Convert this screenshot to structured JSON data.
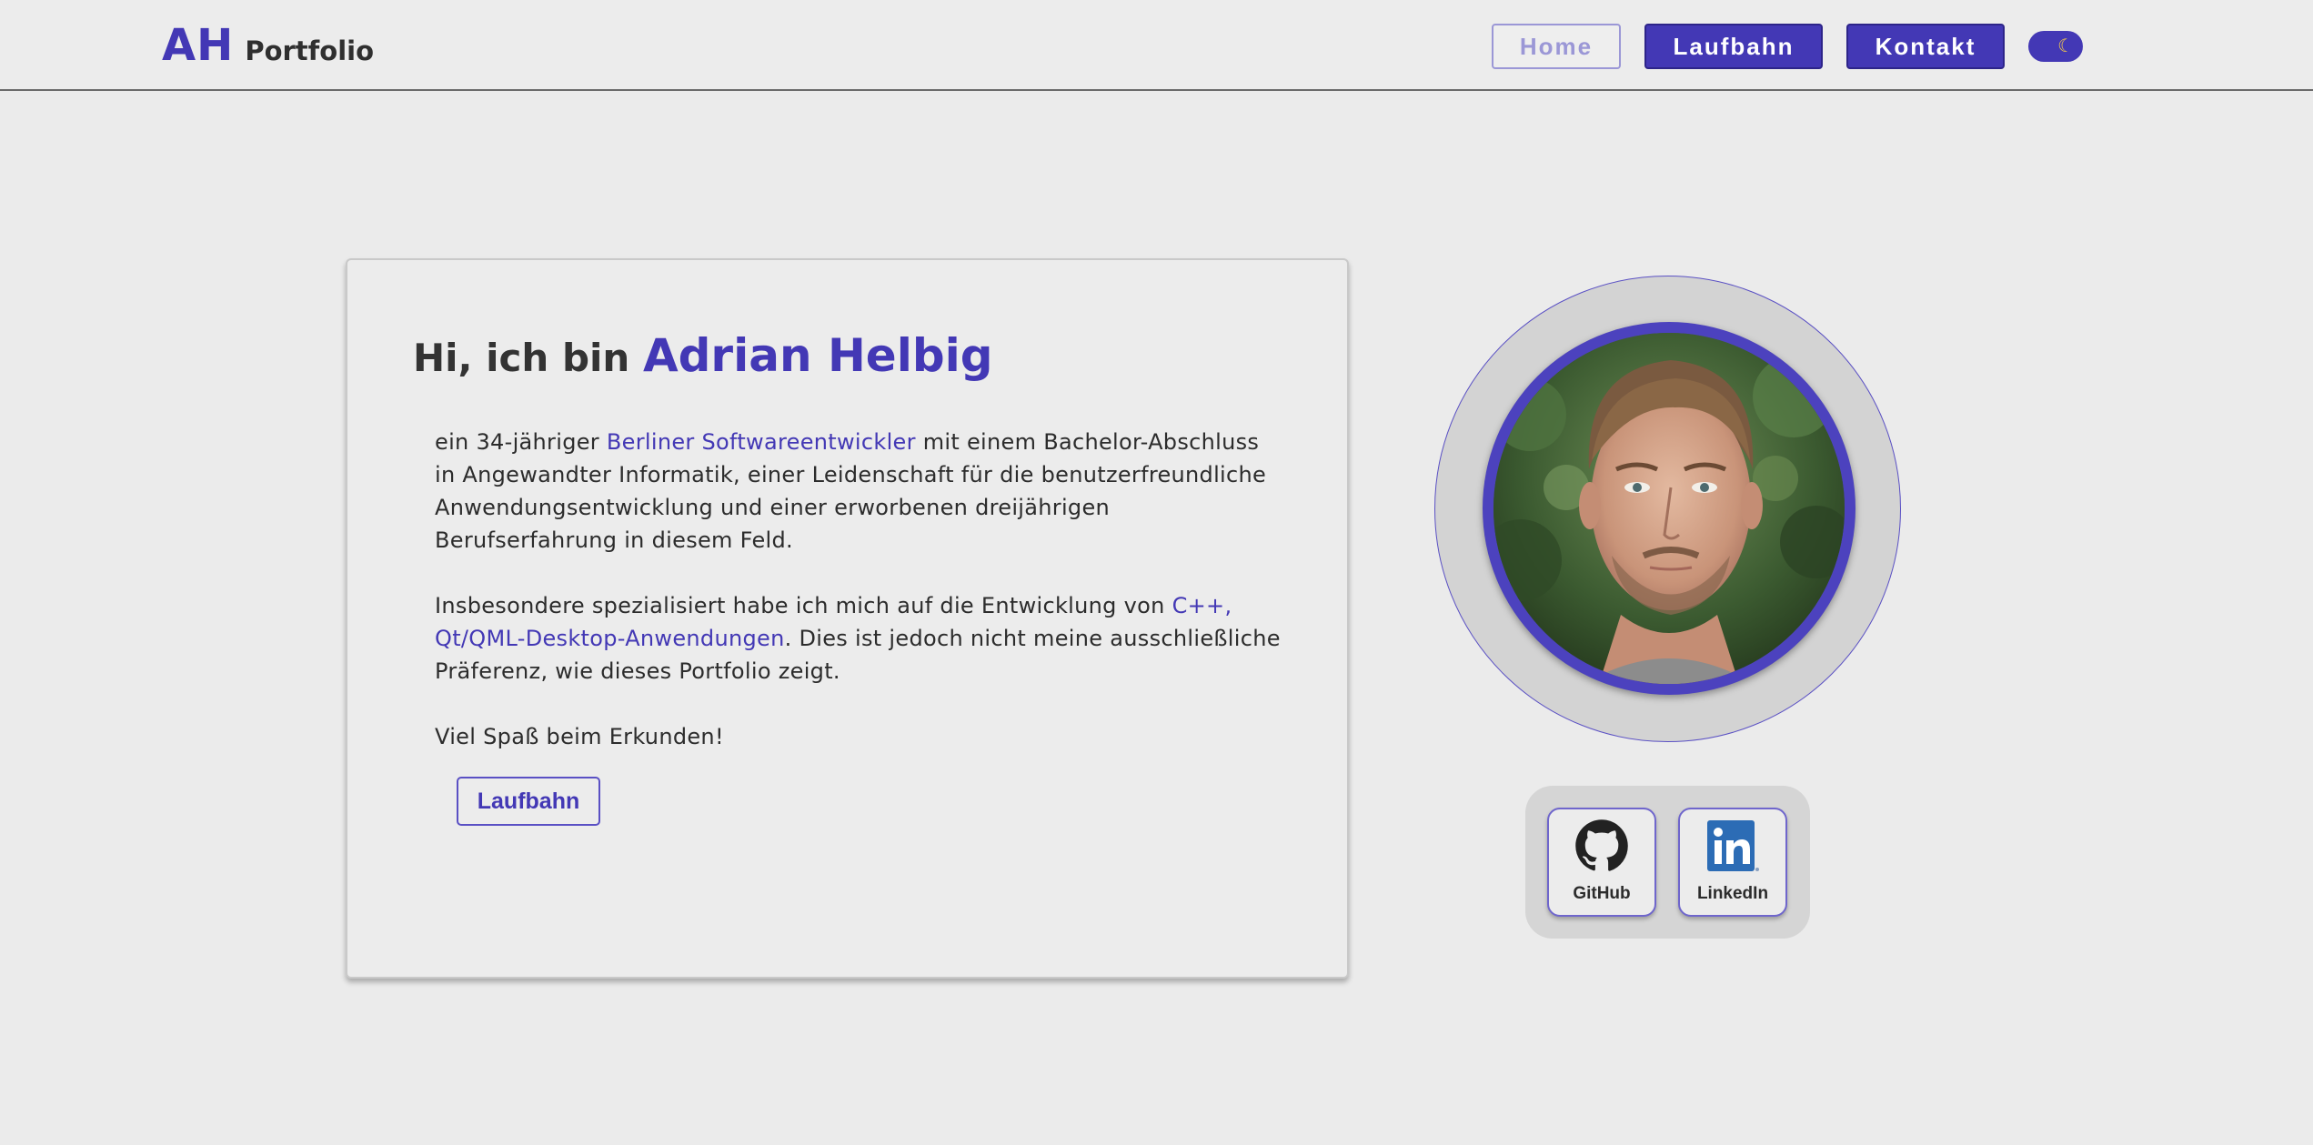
{
  "header": {
    "logo_mark": "AH",
    "logo_text": "Portfolio",
    "nav": {
      "home": "Home",
      "laufbahn": "Laufbahn",
      "kontakt": "Kontakt"
    },
    "theme_toggle_icon": "moon-icon",
    "accent_color": "#4338b5"
  },
  "intro": {
    "greeting_prefix": "Hi, ich bin ",
    "name": "Adrian Helbig",
    "p1": {
      "a": "ein 34-jähriger ",
      "highlight": "Berliner Softwareentwickler",
      "b": " mit einem Bachelor-Abschluss in Angewandter Informatik, einer Leidenschaft für die benutzerfreundliche Anwendungsentwicklung und einer erworbenen dreijährigen Berufserfahrung in diesem Feld."
    },
    "p2": {
      "a": "Insbesondere spezialisiert habe ich mich auf die Entwicklung von ",
      "highlight": "C++, Qt/QML-Desktop-Anwendungen",
      "b": ". Dies ist jedoch nicht meine ausschließliche Präferenz, wie dieses Portfolio zeigt."
    },
    "p3": "Viel Spaß beim Erkunden!",
    "button": "Laufbahn"
  },
  "social": {
    "github": "GitHub",
    "linkedin": "LinkedIn"
  }
}
